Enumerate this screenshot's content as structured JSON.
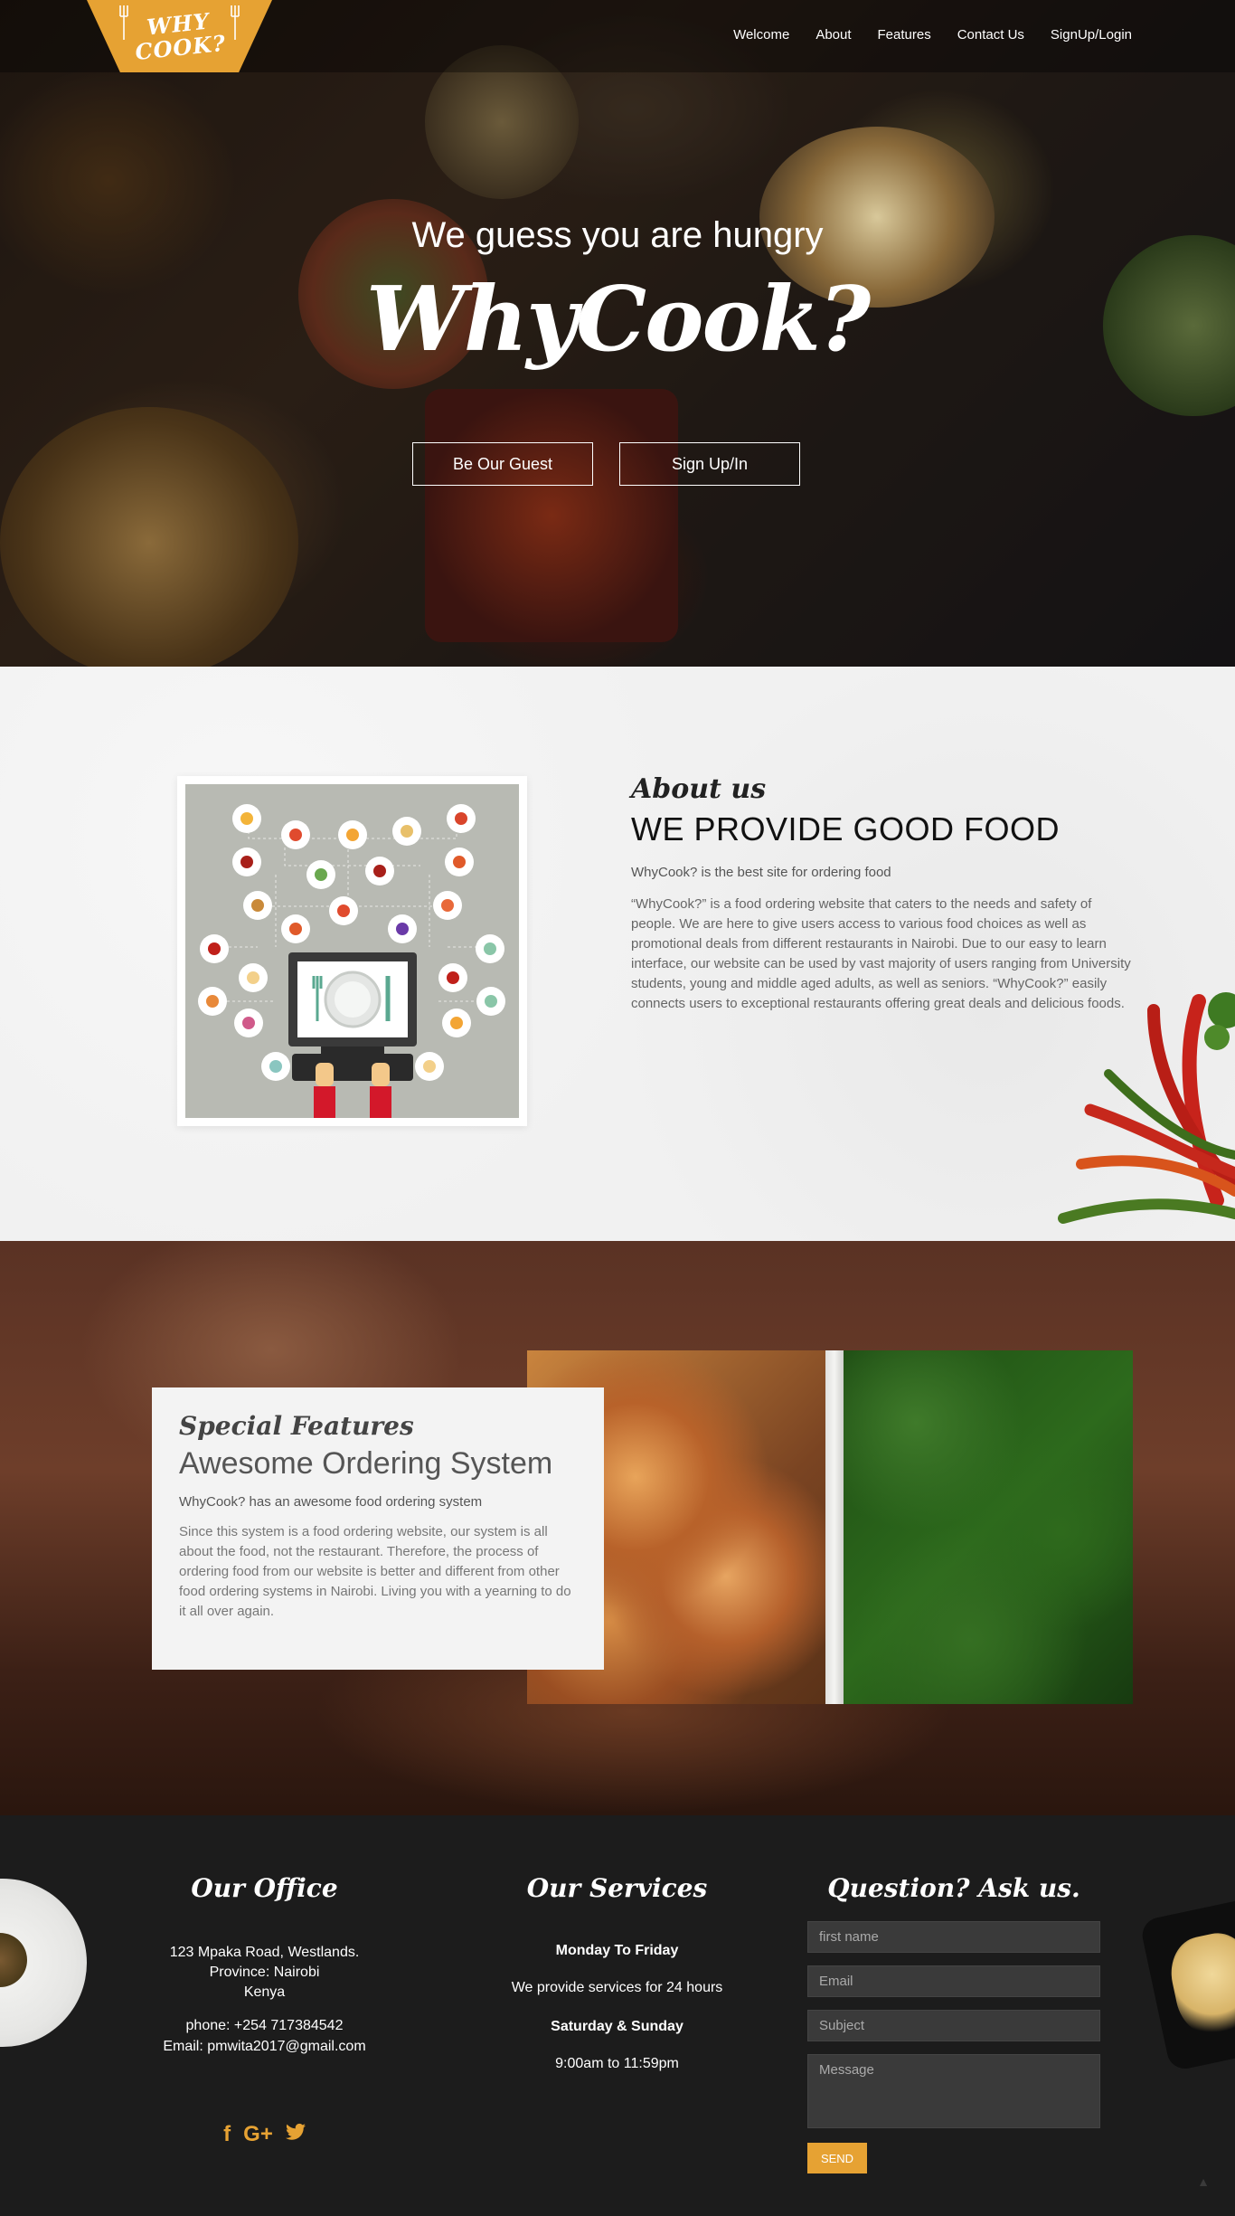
{
  "nav": {
    "logo_text": "WHY\nCOOK?",
    "links": [
      "Welcome",
      "About",
      "Features",
      "Contact Us",
      "SignUp/Login"
    ]
  },
  "hero": {
    "tagline": "We guess you are hungry",
    "title": "WhyCook?",
    "buttons": [
      "Be Our Guest",
      "Sign Up/In"
    ]
  },
  "about": {
    "kicker": "About us",
    "heading": "WE PROVIDE GOOD FOOD",
    "subtitle": "WhyCook? is the best site for ordering food",
    "body": "“WhyCook?” is a food ordering website that caters to the needs and safety of people. We are here to give users access to various food choices as well as promotional deals from different restaurants in Nairobi. Due to our easy to learn interface, our website can be used by vast majority of users ranging from University students, young and middle aged adults, as well as seniors. “WhyCook?” easily connects users to exceptional restaurants offering great deals and delicious foods."
  },
  "features": {
    "kicker": "Special Features",
    "heading": "Awesome Ordering System",
    "subtitle": "WhyCook? has an awesome food ordering system",
    "body": "Since this system is a food ordering website, our system is all about the food, not the restaurant. Therefore, the process of ordering food from our website is better and different from other food ordering systems in Nairobi. Living you with a yearning to do it all over again."
  },
  "footer": {
    "office": {
      "title": "Our Office",
      "address_line1": "123 Mpaka Road, Westlands.",
      "address_line2": "Province: Nairobi",
      "address_line3": "Kenya",
      "phone": "phone: +254 717384542",
      "email": "Email: pmwita2017@gmail.com"
    },
    "social_icons": [
      "facebook-icon",
      "google-plus-icon",
      "twitter-icon"
    ],
    "services": {
      "title": "Our Services",
      "weekday_title": "Monday To Friday",
      "weekday_text": "We provide services for 24 hours",
      "weekend_title": "Saturday & Sunday",
      "weekend_text": "9:00am to 11:59pm"
    },
    "ask": {
      "title": "Question? Ask us.",
      "name_placeholder": "first name",
      "email_placeholder": "Email",
      "subject_placeholder": "Subject",
      "message_placeholder": "Message",
      "send_label": "SEND"
    }
  },
  "colors": {
    "accent": "#e6a233",
    "footer_bg": "#1c1c1c",
    "about_bg": "#f1f1f1"
  }
}
